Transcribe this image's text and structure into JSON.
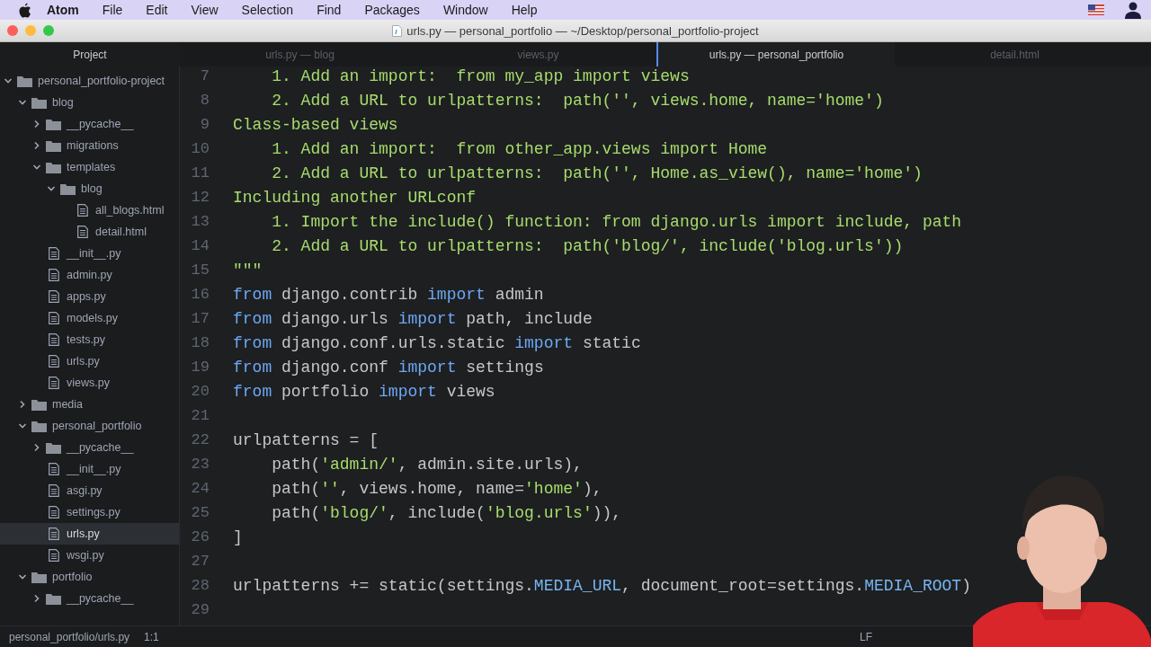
{
  "menu_bar": {
    "app": "Atom",
    "items": [
      "File",
      "Edit",
      "View",
      "Selection",
      "Find",
      "Packages",
      "Window",
      "Help"
    ]
  },
  "window": {
    "title": "urls.py — personal_portfolio — ~/Desktop/personal_portfolio-project"
  },
  "sidebar": {
    "title": "Project",
    "tree": [
      {
        "name": "personal_portfolio-project",
        "kind": "folder",
        "expanded": true,
        "selected": false,
        "children": [
          {
            "name": "blog",
            "kind": "folder",
            "expanded": true,
            "selected": false,
            "children": [
              {
                "name": "__pycache__",
                "kind": "folder",
                "expanded": false,
                "selected": false
              },
              {
                "name": "migrations",
                "kind": "folder",
                "expanded": false,
                "selected": false
              },
              {
                "name": "templates",
                "kind": "folder",
                "expanded": true,
                "selected": false,
                "children": [
                  {
                    "name": "blog",
                    "kind": "folder",
                    "expanded": true,
                    "selected": false,
                    "children": [
                      {
                        "name": "all_blogs.html",
                        "kind": "file",
                        "selected": false
                      },
                      {
                        "name": "detail.html",
                        "kind": "file",
                        "selected": false
                      }
                    ]
                  }
                ]
              },
              {
                "name": "__init__.py",
                "kind": "file",
                "selected": false
              },
              {
                "name": "admin.py",
                "kind": "file",
                "selected": false
              },
              {
                "name": "apps.py",
                "kind": "file",
                "selected": false
              },
              {
                "name": "models.py",
                "kind": "file",
                "selected": false
              },
              {
                "name": "tests.py",
                "kind": "file",
                "selected": false
              },
              {
                "name": "urls.py",
                "kind": "file",
                "selected": false
              },
              {
                "name": "views.py",
                "kind": "file",
                "selected": false
              }
            ]
          },
          {
            "name": "media",
            "kind": "folder",
            "expanded": false,
            "selected": false
          },
          {
            "name": "personal_portfolio",
            "kind": "folder",
            "expanded": true,
            "selected": false,
            "children": [
              {
                "name": "__pycache__",
                "kind": "folder",
                "expanded": false,
                "selected": false
              },
              {
                "name": "__init__.py",
                "kind": "file",
                "selected": false
              },
              {
                "name": "asgi.py",
                "kind": "file",
                "selected": false
              },
              {
                "name": "settings.py",
                "kind": "file",
                "selected": false
              },
              {
                "name": "urls.py",
                "kind": "file",
                "selected": true
              },
              {
                "name": "wsgi.py",
                "kind": "file",
                "selected": false
              }
            ]
          },
          {
            "name": "portfolio",
            "kind": "folder",
            "expanded": true,
            "selected": false,
            "children": [
              {
                "name": "__pycache__",
                "kind": "folder",
                "expanded": false,
                "selected": false
              }
            ]
          }
        ]
      }
    ]
  },
  "tabs": [
    {
      "label": "urls.py — blog",
      "selected": false
    },
    {
      "label": "views.py",
      "selected": false
    },
    {
      "label": "urls.py — personal_portfolio",
      "selected": true
    },
    {
      "label": "detail.html",
      "selected": false
    }
  ],
  "editor": {
    "lines": [
      {
        "n": "7",
        "tokens": [
          {
            "kind": "doc",
            "text": "    1. Add an import:  from my_app import views"
          }
        ]
      },
      {
        "n": "8",
        "tokens": [
          {
            "kind": "doc",
            "text": "    2. Add a URL to urlpatterns:  path('', views.home, name='home')"
          }
        ]
      },
      {
        "n": "9",
        "tokens": [
          {
            "kind": "doc",
            "text": "Class-based views"
          }
        ]
      },
      {
        "n": "10",
        "tokens": [
          {
            "kind": "doc",
            "text": "    1. Add an import:  from other_app.views import Home"
          }
        ]
      },
      {
        "n": "11",
        "tokens": [
          {
            "kind": "doc",
            "text": "    2. Add a URL to urlpatterns:  path('', Home.as_view(), name='home')"
          }
        ]
      },
      {
        "n": "12",
        "tokens": [
          {
            "kind": "doc",
            "text": "Including another URLconf"
          }
        ]
      },
      {
        "n": "13",
        "tokens": [
          {
            "kind": "doc",
            "text": "    1. Import the include() function: from django.urls import include, path"
          }
        ]
      },
      {
        "n": "14",
        "tokens": [
          {
            "kind": "doc",
            "text": "    2. Add a URL to urlpatterns:  path('blog/', include('blog.urls'))"
          }
        ]
      },
      {
        "n": "15",
        "tokens": [
          {
            "kind": "doc",
            "text": "\"\"\""
          }
        ]
      },
      {
        "n": "16",
        "tokens": [
          {
            "kind": "keyword",
            "text": "from"
          },
          {
            "kind": "plain",
            "text": " django.contrib "
          },
          {
            "kind": "keyword",
            "text": "import"
          },
          {
            "kind": "plain",
            "text": " admin"
          }
        ]
      },
      {
        "n": "17",
        "tokens": [
          {
            "kind": "keyword",
            "text": "from"
          },
          {
            "kind": "plain",
            "text": " django.urls "
          },
          {
            "kind": "keyword",
            "text": "import"
          },
          {
            "kind": "plain",
            "text": " path, include"
          }
        ]
      },
      {
        "n": "18",
        "tokens": [
          {
            "kind": "keyword",
            "text": "from"
          },
          {
            "kind": "plain",
            "text": " django.conf.urls.static "
          },
          {
            "kind": "keyword",
            "text": "import"
          },
          {
            "kind": "plain",
            "text": " static"
          }
        ]
      },
      {
        "n": "19",
        "tokens": [
          {
            "kind": "keyword",
            "text": "from"
          },
          {
            "kind": "plain",
            "text": " django.conf "
          },
          {
            "kind": "keyword",
            "text": "import"
          },
          {
            "kind": "plain",
            "text": " settings"
          }
        ]
      },
      {
        "n": "20",
        "tokens": [
          {
            "kind": "keyword",
            "text": "from"
          },
          {
            "kind": "plain",
            "text": " portfolio "
          },
          {
            "kind": "keyword",
            "text": "import"
          },
          {
            "kind": "plain",
            "text": " views"
          }
        ]
      },
      {
        "n": "21"
      },
      {
        "n": "22",
        "tokens": [
          {
            "kind": "plain",
            "text": "urlpatterns = ["
          }
        ]
      },
      {
        "n": "23",
        "tokens": [
          {
            "kind": "plain",
            "text": "    path("
          },
          {
            "kind": "string",
            "text": "'admin/'"
          },
          {
            "kind": "plain",
            "text": ", admin.site.urls),"
          }
        ]
      },
      {
        "n": "24",
        "tokens": [
          {
            "kind": "plain",
            "text": "    path("
          },
          {
            "kind": "string",
            "text": "''"
          },
          {
            "kind": "plain",
            "text": ", views.home, name="
          },
          {
            "kind": "string",
            "text": "'home'"
          },
          {
            "kind": "plain",
            "text": "),"
          }
        ]
      },
      {
        "n": "25",
        "tokens": [
          {
            "kind": "plain",
            "text": "    path("
          },
          {
            "kind": "string",
            "text": "'blog/'"
          },
          {
            "kind": "plain",
            "text": ", include("
          },
          {
            "kind": "string",
            "text": "'blog.urls'"
          },
          {
            "kind": "plain",
            "text": ")),"
          }
        ]
      },
      {
        "n": "26",
        "tokens": [
          {
            "kind": "plain",
            "text": "]"
          }
        ]
      },
      {
        "n": "27"
      },
      {
        "n": "28",
        "tokens": [
          {
            "kind": "plain",
            "text": "urlpatterns += static(settings."
          },
          {
            "kind": "constant",
            "text": "MEDIA_URL"
          },
          {
            "kind": "plain",
            "text": ", document_root=settings."
          },
          {
            "kind": "constant",
            "text": "MEDIA_ROOT"
          },
          {
            "kind": "plain",
            "text": ")"
          }
        ]
      },
      {
        "n": "29"
      }
    ]
  },
  "status_bar": {
    "path": "personal_portfolio/urls.py",
    "cursor": "1:1",
    "line_ending": "LF"
  }
}
